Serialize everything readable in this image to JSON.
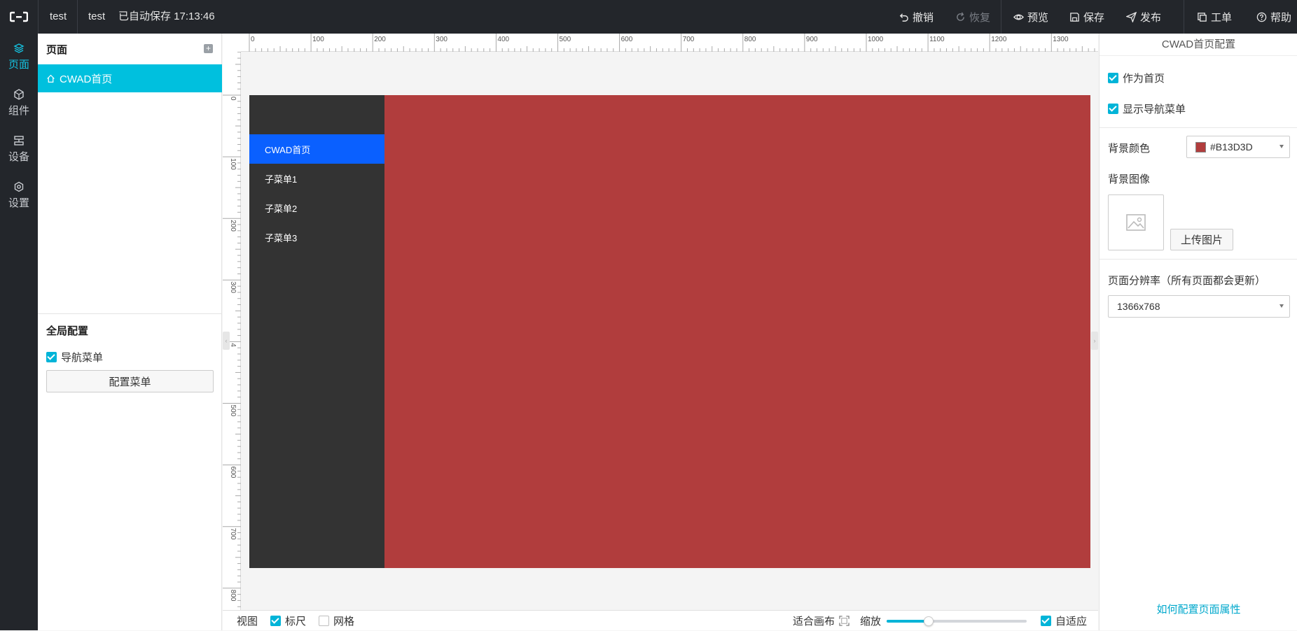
{
  "topbar": {
    "project_name": "test",
    "page_name": "test",
    "autosave_text": "已自动保存 17:13:46",
    "undo_label": "撤销",
    "redo_label": "恢复",
    "preview_label": "预览",
    "save_label": "保存",
    "publish_label": "发布",
    "ticket_label": "工单",
    "help_label": "帮助"
  },
  "rail": {
    "items": [
      {
        "label": "页面",
        "icon": "layers-icon",
        "active": true
      },
      {
        "label": "组件",
        "icon": "cube-icon",
        "active": false
      },
      {
        "label": "设备",
        "icon": "device-icon",
        "active": false
      },
      {
        "label": "设置",
        "icon": "gear-icon",
        "active": false
      }
    ]
  },
  "pages_panel": {
    "title": "页面",
    "add_icon": "plus-square-icon",
    "pages": [
      {
        "label": "CWAD首页",
        "icon": "home-icon",
        "selected": true
      }
    ],
    "global_title": "全局配置",
    "nav_menu_checkbox": {
      "label": "导航菜单",
      "checked": true
    },
    "config_menu_button": "配置菜单"
  },
  "canvas": {
    "ruler_top_labels": [
      "0",
      "100",
      "200",
      "300",
      "400",
      "500",
      "600",
      "700",
      "800",
      "900",
      "1000",
      "1100",
      "1200",
      "1300"
    ],
    "ruler_left_labels": [
      "0",
      "100",
      "200",
      "300",
      "4",
      "500",
      "600",
      "700",
      "800"
    ],
    "background_color": "#B13D3D",
    "nav_background": "#333333",
    "nav_active_color": "#0A60FF",
    "nav_items": [
      {
        "label": "CWAD首页",
        "active": true
      },
      {
        "label": "子菜单1",
        "active": false
      },
      {
        "label": "子菜单2",
        "active": false
      },
      {
        "label": "子菜单3",
        "active": false
      }
    ]
  },
  "bottombar": {
    "view_label": "视图",
    "ruler_checkbox": {
      "label": "标尺",
      "checked": true
    },
    "grid_checkbox": {
      "label": "网格",
      "checked": false
    },
    "fit_canvas_label": "适合画布",
    "zoom_label": "缩放",
    "zoom_level": 0.3,
    "auto_fit_checkbox": {
      "label": "自适应",
      "checked": true
    }
  },
  "right_panel": {
    "title": "CWAD首页配置",
    "set_home_checkbox": {
      "label": "作为首页",
      "checked": true
    },
    "show_nav_checkbox": {
      "label": "显示导航菜单",
      "checked": true
    },
    "bg_color_label": "背景颜色",
    "bg_color_value": "#B13D3D",
    "bg_image_label": "背景图像",
    "upload_button": "上传图片",
    "resolution_label": "页面分辨率（所有页面都会更新）",
    "resolution_value": "1366x768",
    "help_link": "如何配置页面属性"
  },
  "colors": {
    "accent": "#00C0DE",
    "topbar_bg": "#23262B"
  }
}
